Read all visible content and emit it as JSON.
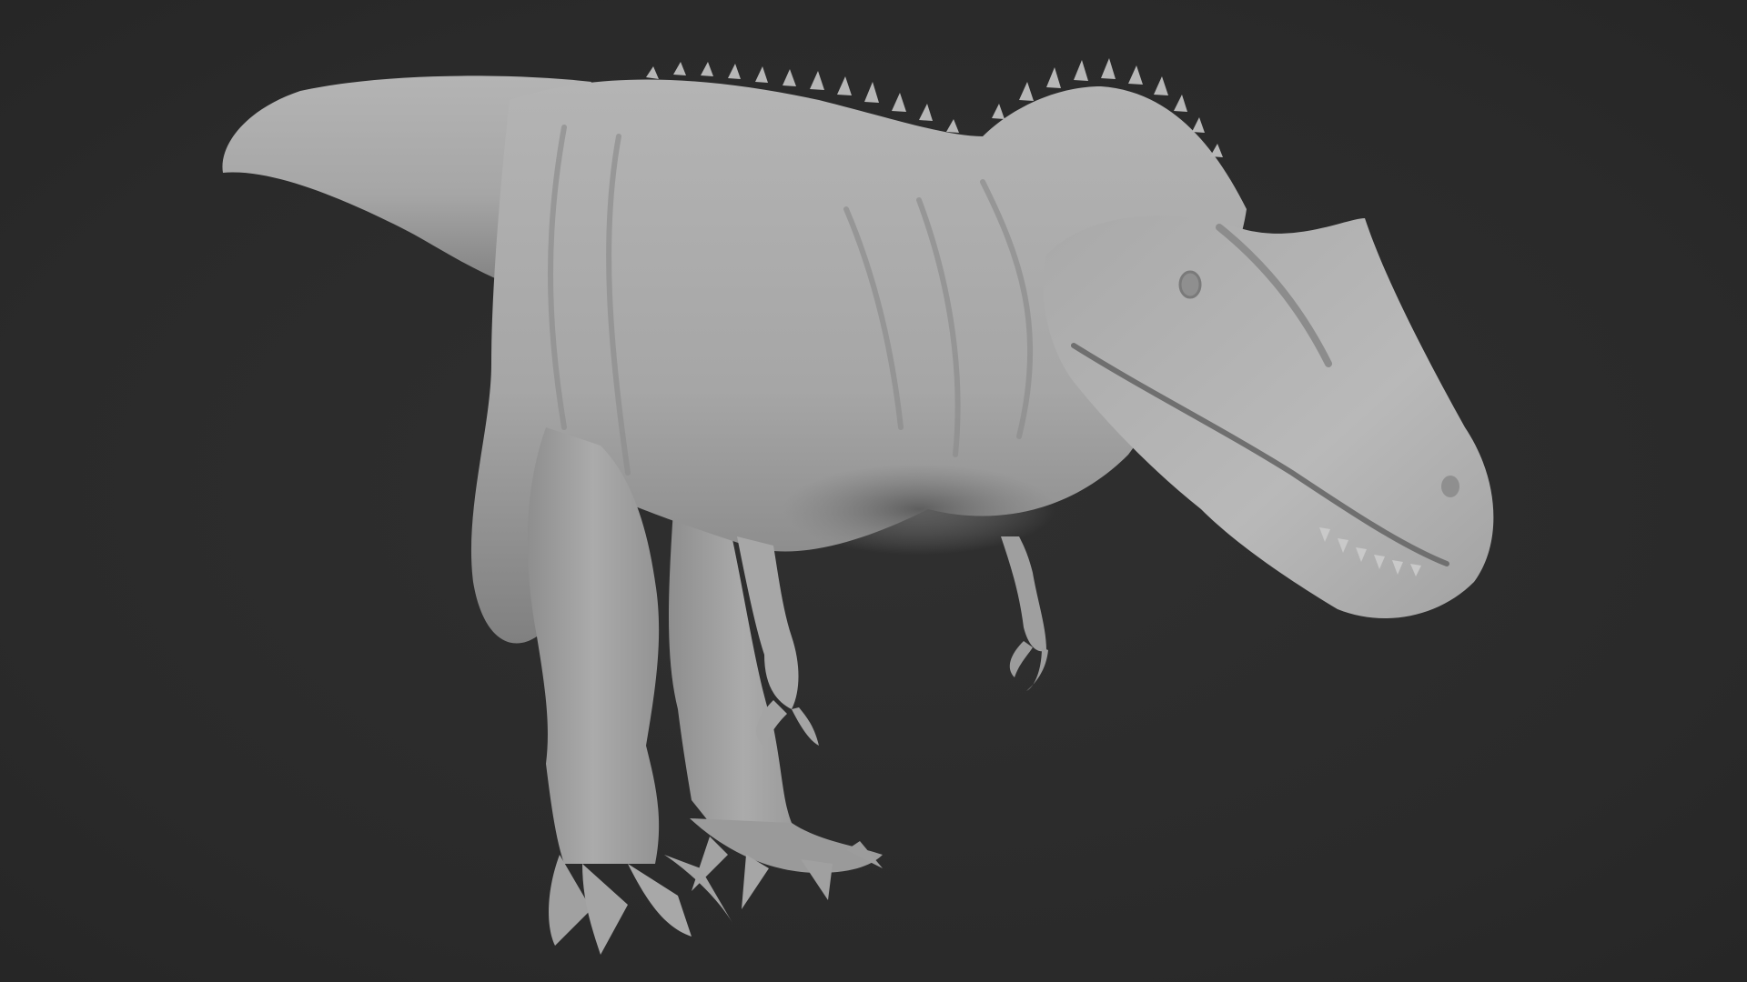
{
  "scene": {
    "subject": "dinosaur-sculpt",
    "background_color": "#2b2b2b",
    "model_color": "#a9a9a9",
    "shadow_color": "#6e6e6e",
    "highlight_color": "#c8c8c8"
  }
}
